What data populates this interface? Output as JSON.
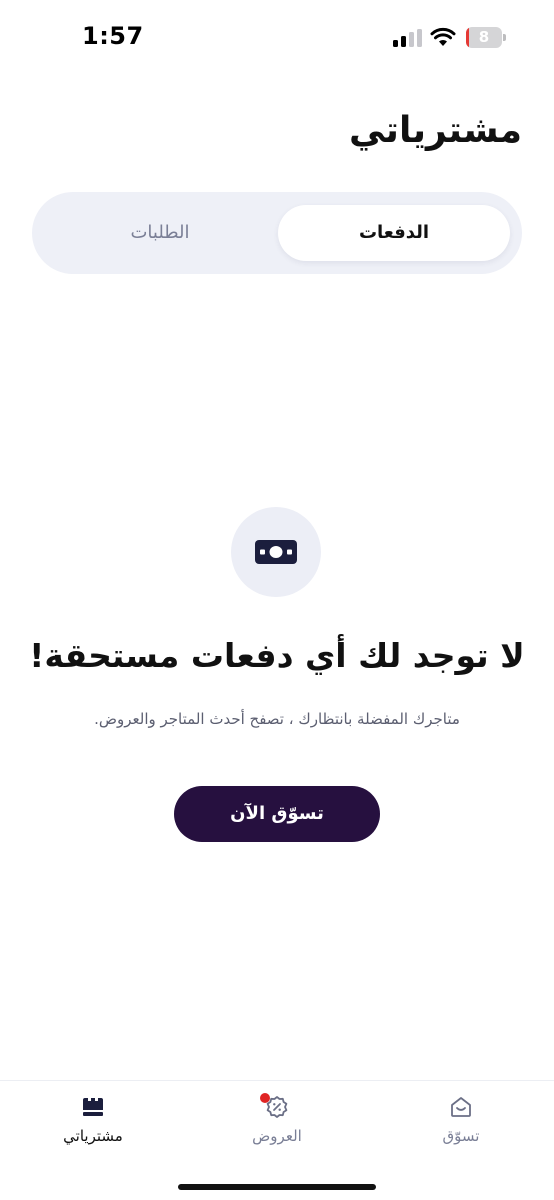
{
  "status_bar": {
    "time": "1:57",
    "battery_level": "8",
    "battery_fraction": 0.08,
    "icons": [
      "cellular-signal-icon",
      "wifi-icon",
      "battery-icon"
    ]
  },
  "header": {
    "title": "مشترياتي"
  },
  "tabs": [
    {
      "label": "الدفعات",
      "selected": true
    },
    {
      "label": "الطلبات",
      "selected": false
    }
  ],
  "empty_state": {
    "icon": "money-icon",
    "title": "لا توجد لك أي دفعات مستحقة!",
    "subtitle": "متاجرك المفضلة بانتظارك ، تصفح أحدث المتاجر والعروض.",
    "button_label": "تسوّق الآن"
  },
  "bottom_nav": {
    "items": [
      {
        "label": "مشترياتي",
        "icon": "purchases-icon",
        "active": true
      },
      {
        "label": "العروض",
        "icon": "offers-badge-icon",
        "active": false,
        "has_notification": true
      },
      {
        "label": "تسوّق",
        "icon": "shop-home-icon",
        "active": false
      }
    ]
  },
  "colors": {
    "primary_button": "#26103f",
    "tabs_background": "#eef0f7",
    "notification_dot": "#e02424",
    "battery_low": "#e53935",
    "inactive_text": "#7a7f96"
  }
}
